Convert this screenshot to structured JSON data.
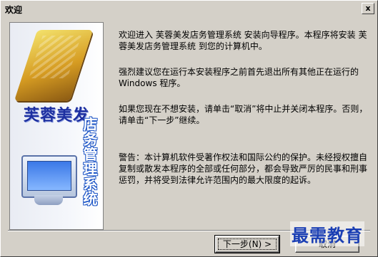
{
  "window": {
    "title": "欢迎",
    "close_glyph": "x"
  },
  "side_panel": {
    "brand_name": "芙蓉美发",
    "subtitle": "店务管理系统"
  },
  "paragraphs": {
    "p1": "欢迎进入 芙蓉美发店务管理系统 安装向导程序。本程序将安装 芙蓉美发店务管理系统 到您的计算机中。",
    "p2": "强烈建议您在运行本安装程序之前首先退出所有其他正在运行的 Windows 程序。",
    "p3": "如果您现在不想安装，请单击“取消”将中止并关闭本程序。否则，请单击“下一步”继续。",
    "p4": "警告：本计算机软件受著作权法和国际公约的保护。未经授权擅自复制或散发本程序的全部或任何部分，都会导致严厉的民事和刑事惩罚，并将受到法律允许范围内的最大限度的起诉。"
  },
  "buttons": {
    "next": "下一步(N) >",
    "cancel": "取消"
  },
  "watermark": "最需教育",
  "colors": {
    "brand_blue": "#1d2fa0",
    "watermark_blue": "#1b3fb4",
    "dialog_bg": "#d4d0c8"
  }
}
